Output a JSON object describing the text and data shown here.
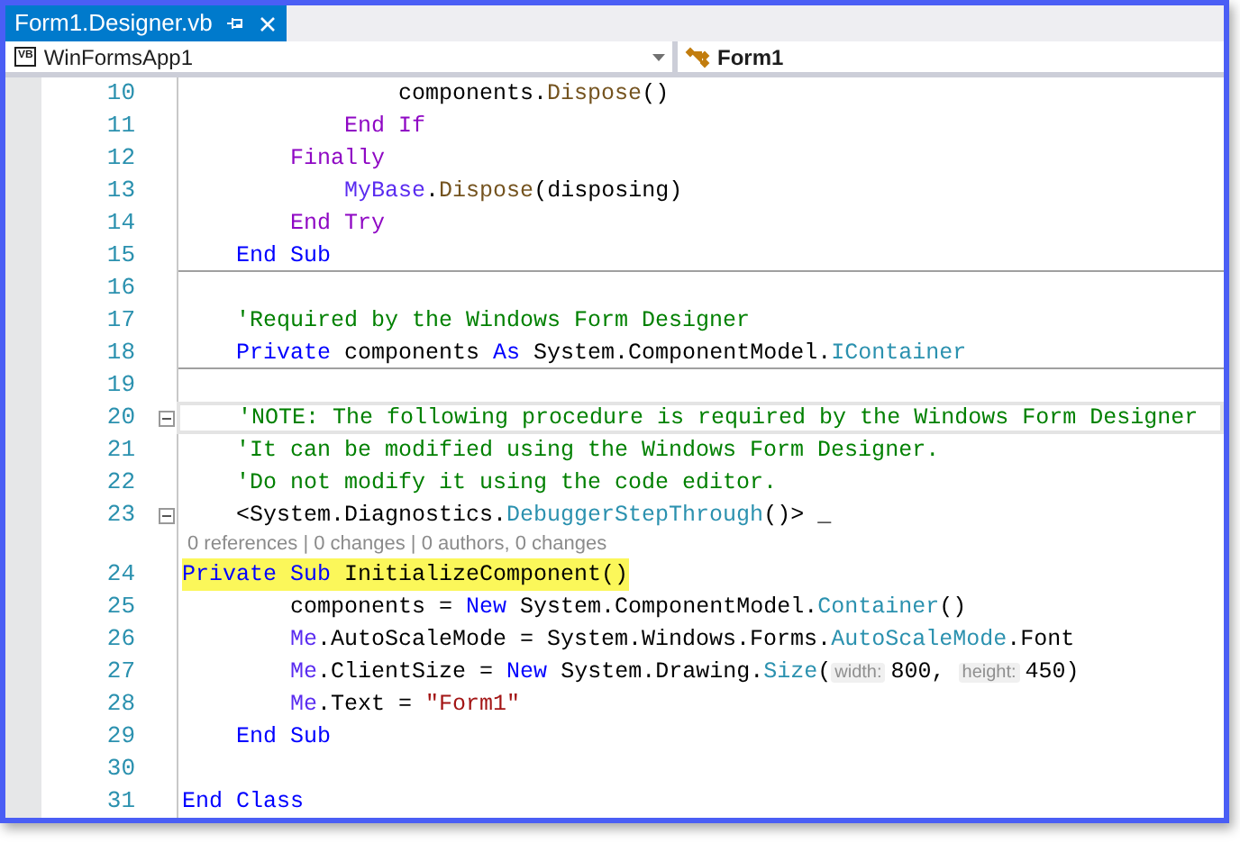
{
  "tabs": [
    {
      "title": "Form1.Designer.vb",
      "selected": true
    }
  ],
  "nav_bar": {
    "project_icon": "VB",
    "project": "WinFormsApp1",
    "member": "Form1"
  },
  "lines": [
    {
      "kind": "code",
      "number": "10",
      "tokens": [
        {
          "kind": "plain",
          "text": "                components."
        },
        {
          "kind": "method",
          "text": "Dispose"
        },
        {
          "kind": "plain",
          "text": "()"
        }
      ]
    },
    {
      "kind": "code",
      "number": "11",
      "tokens": [
        {
          "kind": "ctrl",
          "text": "            End If"
        }
      ]
    },
    {
      "kind": "code",
      "number": "12",
      "tokens": [
        {
          "kind": "ctrl",
          "text": "        Finally"
        }
      ]
    },
    {
      "kind": "code",
      "number": "13",
      "tokens": [
        {
          "kind": "me",
          "text": "            MyBase"
        },
        {
          "kind": "plain",
          "text": "."
        },
        {
          "kind": "method",
          "text": "Dispose"
        },
        {
          "kind": "plain",
          "text": "(disposing)"
        }
      ]
    },
    {
      "kind": "code",
      "number": "14",
      "tokens": [
        {
          "kind": "ctrl",
          "text": "        End Try"
        }
      ]
    },
    {
      "kind": "code",
      "number": "15",
      "separator": true,
      "tokens": [
        {
          "kind": "kw",
          "text": "    End Sub"
        }
      ]
    },
    {
      "kind": "code",
      "number": "16"
    },
    {
      "kind": "code",
      "number": "17",
      "tokens": [
        {
          "kind": "comment",
          "text": "    'Required by the Windows Form Designer"
        }
      ]
    },
    {
      "kind": "code",
      "number": "18",
      "separator": true,
      "tokens": [
        {
          "kind": "kw",
          "text": "    Private"
        },
        {
          "kind": "plain",
          "text": " components "
        },
        {
          "kind": "kw",
          "text": "As"
        },
        {
          "kind": "plain",
          "text": " System.ComponentModel."
        },
        {
          "kind": "type",
          "text": "IContainer"
        }
      ]
    },
    {
      "kind": "code",
      "number": "19"
    },
    {
      "kind": "code",
      "number": "20",
      "current": true,
      "expanded": true,
      "tokens": [
        {
          "kind": "comment",
          "text": "    'NOTE: The following procedure is required by the Windows Form Designer"
        }
      ]
    },
    {
      "kind": "code",
      "number": "21",
      "tokens": [
        {
          "kind": "comment",
          "text": "    'It can be modified using the Windows Form Designer."
        }
      ]
    },
    {
      "kind": "code",
      "number": "22",
      "tokens": [
        {
          "kind": "comment",
          "text": "    'Do not modify it using the code editor."
        }
      ]
    },
    {
      "kind": "code",
      "number": "23",
      "expanded": true,
      "tokens": [
        {
          "kind": "plain",
          "text": "    <System.Diagnostics."
        },
        {
          "kind": "type",
          "text": "DebuggerStepThrough"
        },
        {
          "kind": "plain",
          "text": "()> _"
        }
      ]
    },
    {
      "kind": "codelens",
      "text": "0 references | 0 changes | 0 authors, 0 changes"
    },
    {
      "kind": "code",
      "number": "24",
      "highlighted": true,
      "tokens": [
        {
          "kind": "kw",
          "text": "Private Sub"
        },
        {
          "kind": "plain",
          "text": " InitializeComponent()"
        }
      ]
    },
    {
      "kind": "code",
      "number": "25",
      "tokens": [
        {
          "kind": "plain",
          "text": "        components = "
        },
        {
          "kind": "kw",
          "text": "New"
        },
        {
          "kind": "plain",
          "text": " System.ComponentModel."
        },
        {
          "kind": "type",
          "text": "Container"
        },
        {
          "kind": "plain",
          "text": "()"
        }
      ]
    },
    {
      "kind": "code",
      "number": "26",
      "tokens": [
        {
          "kind": "me",
          "text": "        Me"
        },
        {
          "kind": "plain",
          "text": ".AutoScaleMode = System.Windows.Forms."
        },
        {
          "kind": "type",
          "text": "AutoScaleMode"
        },
        {
          "kind": "plain",
          "text": ".Font"
        }
      ]
    },
    {
      "kind": "code",
      "number": "27",
      "tokens": [
        {
          "kind": "me",
          "text": "        Me"
        },
        {
          "kind": "plain",
          "text": ".ClientSize = "
        },
        {
          "kind": "kw",
          "text": "New"
        },
        {
          "kind": "plain",
          "text": " System.Drawing."
        },
        {
          "kind": "type",
          "text": "Size"
        },
        {
          "kind": "plain",
          "text": "("
        },
        {
          "kind": "hint",
          "text": "width:"
        },
        {
          "kind": "plain",
          "text": "800, "
        },
        {
          "kind": "hint",
          "text": "height:"
        },
        {
          "kind": "plain",
          "text": "450)"
        }
      ]
    },
    {
      "kind": "code",
      "number": "28",
      "tokens": [
        {
          "kind": "me",
          "text": "        Me"
        },
        {
          "kind": "plain",
          "text": ".Text = "
        },
        {
          "kind": "string",
          "text": "\"Form1\""
        }
      ]
    },
    {
      "kind": "code",
      "number": "29",
      "tokens": [
        {
          "kind": "kw",
          "text": "    End Sub"
        }
      ]
    },
    {
      "kind": "code",
      "number": "30"
    },
    {
      "kind": "code",
      "number": "31",
      "tokens": [
        {
          "kind": "kw",
          "text": "End Class"
        }
      ]
    }
  ]
}
